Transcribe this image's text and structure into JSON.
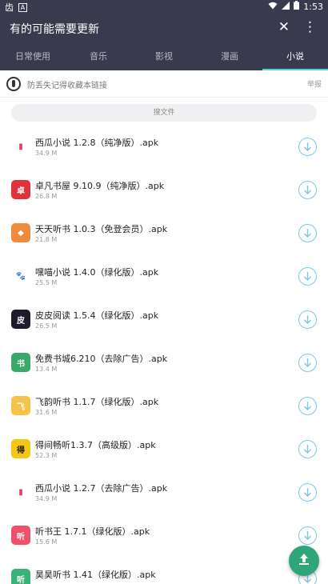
{
  "statusbar": {
    "time": "1:53",
    "app_glyph": "齿",
    "box_glyph": "A"
  },
  "appbar": {
    "title": "有的可能需要更新",
    "close_glyph": "✕",
    "more_glyph": "⋮"
  },
  "tabs": [
    {
      "label": "日常使用",
      "active": false
    },
    {
      "label": "音乐",
      "active": false
    },
    {
      "label": "影视",
      "active": false
    },
    {
      "label": "漫画",
      "active": false
    },
    {
      "label": "小说",
      "active": true
    }
  ],
  "notice": {
    "text": "防丢失记得收藏本链接",
    "report": "举报"
  },
  "search": {
    "placeholder": "搜文件"
  },
  "files": [
    {
      "name": "西瓜小说 1.2.8（纯净版）.apk",
      "size": "34.9 M",
      "icon_color": "#e63f5b",
      "icon_bg": "#ffffff",
      "icon_glyph": "▮"
    },
    {
      "name": "卓凡书屋 9.10.9（纯净版）.apk",
      "size": "26.8 M",
      "icon_color": "#ffffff",
      "icon_bg": "#e0323a",
      "icon_glyph": "卓"
    },
    {
      "name": "天天听书 1.0.3（免登会员）.apk",
      "size": "21.8 M",
      "icon_color": "#ffffff",
      "icon_bg": "#f08a3c",
      "icon_glyph": "◆"
    },
    {
      "name": "嘿喵小说 1.4.0（绿化版）.apk",
      "size": "25.5 M",
      "icon_color": "#222222",
      "icon_bg": "#ffffff",
      "icon_glyph": "🐾"
    },
    {
      "name": "皮皮阅读 1.5.4（绿化版）.apk",
      "size": "26.5 M",
      "icon_color": "#ffffff",
      "icon_bg": "#1c1c2c",
      "icon_glyph": "皮"
    },
    {
      "name": "免费书城6.210（去除广告）.apk",
      "size": "13.4 M",
      "icon_color": "#ffffff",
      "icon_bg": "#3aa86a",
      "icon_glyph": "书"
    },
    {
      "name": "飞韵听书 1.1.7（绿化版）.apk",
      "size": "31.6 M",
      "icon_color": "#ffffff",
      "icon_bg": "#f6c24a",
      "icon_glyph": "飞"
    },
    {
      "name": "得间畅听1.3.7（高级版）.apk",
      "size": "52.3 M",
      "icon_color": "#222222",
      "icon_bg": "#f5c518",
      "icon_glyph": "得"
    },
    {
      "name": "西瓜小说 1.2.7（去除广告）.apk",
      "size": "34.9 M",
      "icon_color": "#e63f5b",
      "icon_bg": "#ffffff",
      "icon_glyph": "▮"
    },
    {
      "name": "听书王 1.7.1（绿化版）.apk",
      "size": "15.6 M",
      "icon_color": "#ffffff",
      "icon_bg": "#f0506a",
      "icon_glyph": "听"
    },
    {
      "name": "昊昊听书 1.41（绿化版）.apk",
      "size": "",
      "icon_color": "#ffffff",
      "icon_bg": "#3bb27a",
      "icon_glyph": "听"
    }
  ],
  "colors": {
    "appbar": "#3a3a4e",
    "tab_indicator": "#4fd6d0",
    "download_ring": "#7ac7e8",
    "fab": "#2fa679"
  }
}
